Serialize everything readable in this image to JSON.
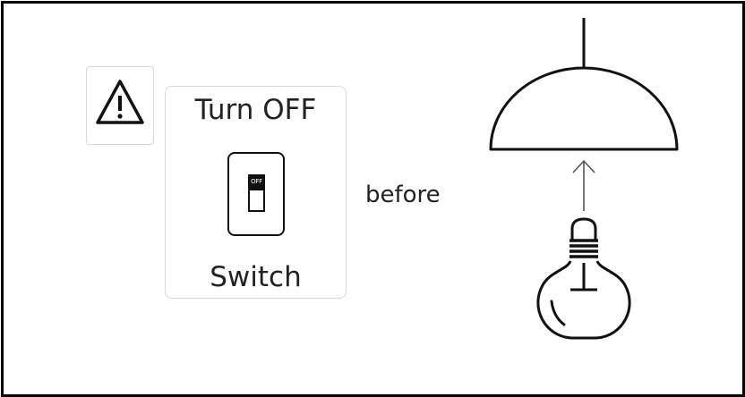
{
  "warning": {
    "icon": "warning-triangle-icon"
  },
  "switch_card": {
    "title": "Turn OFF",
    "toggle_text": "OFF",
    "label": "Switch",
    "icon": "light-switch-icon"
  },
  "connector": {
    "text": "before"
  },
  "lamp": {
    "shade_icon": "lamp-shade-icon",
    "arrow_icon": "arrow-up-icon",
    "bulb_icon": "light-bulb-icon"
  }
}
